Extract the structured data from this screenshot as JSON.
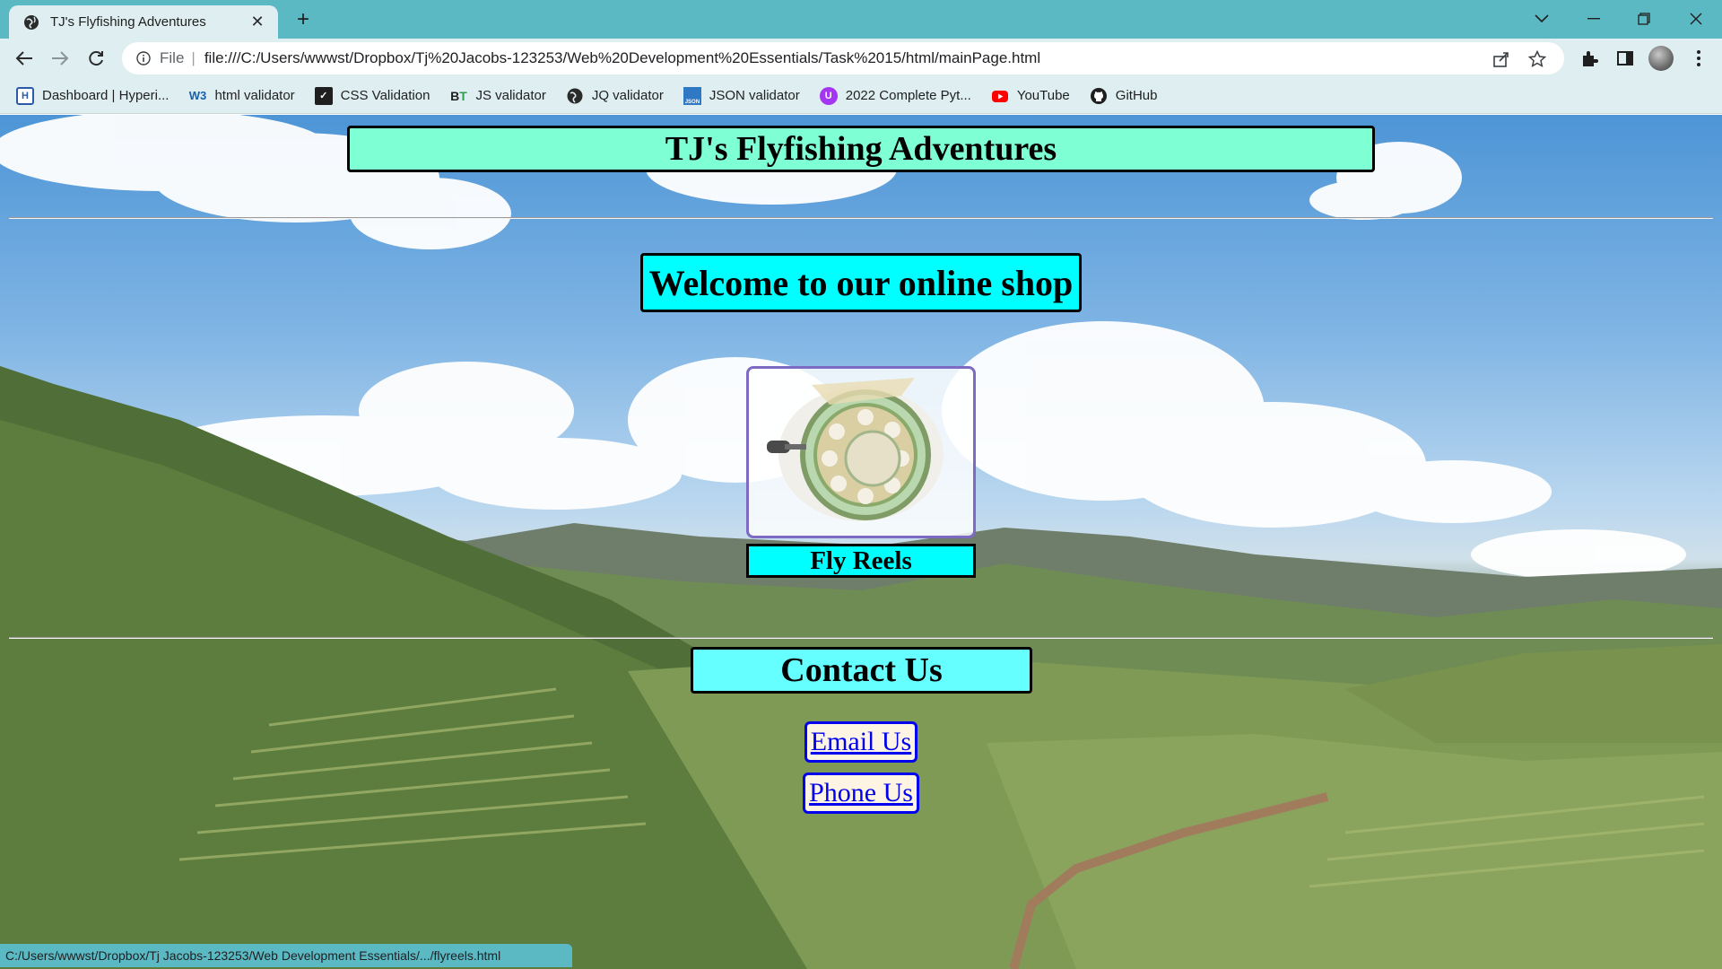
{
  "browser": {
    "tab": {
      "title": "TJ's Flyfishing Adventures",
      "close_icon": "close-icon"
    },
    "new_tab_icon": "plus-icon",
    "window_controls": [
      "chevron-down-icon",
      "minimize-icon",
      "restore-icon",
      "close-icon"
    ],
    "address_bar": {
      "scheme_label": "File",
      "separator": "|",
      "url": "file:///C:/Users/wwwst/Dropbox/Tj%20Jacobs-123253/Web%20Development%20Essentials/Task%2015/html/mainPage.html"
    },
    "bookmarks": [
      {
        "label": "Dashboard | Hyperi...",
        "icon": "hyperion-icon"
      },
      {
        "label": "html validator",
        "icon": "w3c-icon"
      },
      {
        "label": "CSS Validation",
        "icon": "css-icon"
      },
      {
        "label": "JS validator",
        "icon": "bt-icon"
      },
      {
        "label": "JQ validator",
        "icon": "globe-icon"
      },
      {
        "label": "JSON validator",
        "icon": "json-icon"
      },
      {
        "label": "2022 Complete Pyt...",
        "icon": "udemy-icon"
      },
      {
        "label": "YouTube",
        "icon": "youtube-icon"
      },
      {
        "label": "GitHub",
        "icon": "github-icon"
      }
    ],
    "status_url": "C:/Users/wwwst/Dropbox/Tj Jacobs-123253/Web Development Essentials/.../flyreels.html"
  },
  "page": {
    "site_title": "TJ's Flyfishing Adventures",
    "welcome_heading": "Welcome to our online shop",
    "product": {
      "label": "Fly Reels",
      "image_icon": "fly-reel-image"
    },
    "contact": {
      "heading": "Contact Us",
      "email_link": "Email Us",
      "phone_link": "Phone Us"
    }
  },
  "colors": {
    "chrome_accent": "#5bb9c4",
    "chrome_surface": "#dfeff1",
    "title_box": "#7fffd4",
    "heading_box": "#00ffff",
    "contact_box": "#66ffff",
    "link": "#0000ee"
  }
}
